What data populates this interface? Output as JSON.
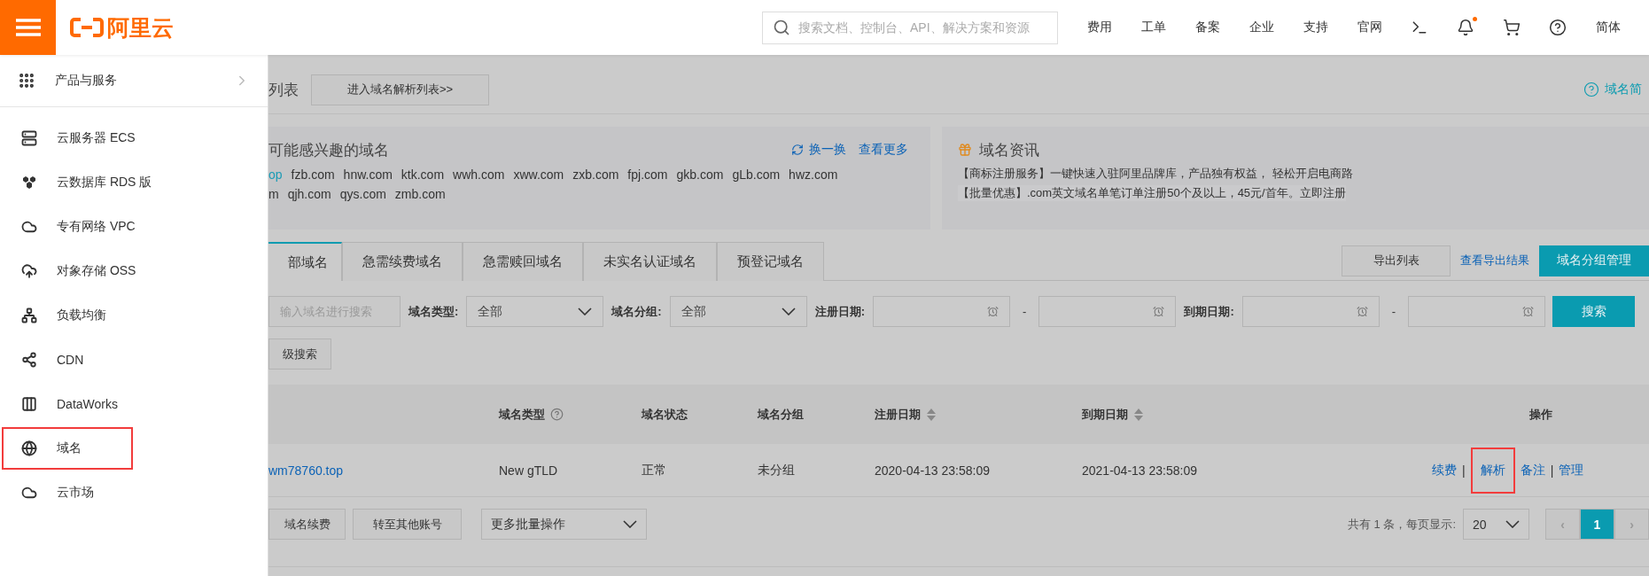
{
  "topbar": {
    "logo": "阿里云",
    "search": {
      "placeholder": "搜索文档、控制台、API、解决方案和资源"
    },
    "nav": [
      "费用",
      "工单",
      "备案",
      "企业",
      "支持",
      "官网"
    ],
    "icons": [
      {
        "kind": "terminal",
        "dot": false
      },
      {
        "kind": "bell",
        "dot": true
      },
      {
        "kind": "cart",
        "dot": false
      },
      {
        "kind": "help",
        "dot": false
      }
    ],
    "language": "简体"
  },
  "sidebar": {
    "header": "产品与服务",
    "items": [
      {
        "label": "云服务器 ECS",
        "highlighted": false
      },
      {
        "label": "云数据库 RDS 版",
        "highlighted": false
      },
      {
        "label": "专有网络 VPC",
        "highlighted": false
      },
      {
        "label": "对象存储 OSS",
        "highlighted": false
      },
      {
        "label": "负载均衡",
        "highlighted": false
      },
      {
        "label": "CDN",
        "highlighted": false
      },
      {
        "label": "DataWorks",
        "highlighted": false
      },
      {
        "label": "域名",
        "highlighted": true
      },
      {
        "label": "云市场",
        "highlighted": false
      }
    ]
  },
  "page": {
    "title": "列表",
    "resolve_button": "进入域名解析列表>>",
    "help_link": "域名简",
    "suggest": {
      "title": "可能感兴趣的域名",
      "refresh": "换一换",
      "more": "查看更多",
      "lines": [
        [
          {
            "text": "op",
            "color": "#1a9bb5"
          },
          {
            "text": "fzb.com",
            "color": "#333333"
          },
          {
            "text": "hnw.com",
            "color": "#333333"
          },
          {
            "text": "ktk.com",
            "color": "#333333"
          },
          {
            "text": "wwh.com",
            "color": "#333333"
          },
          {
            "text": "xww.com",
            "color": "#333333"
          },
          {
            "text": "zxb.com",
            "color": "#333333"
          },
          {
            "text": "fpj.com",
            "color": "#333333"
          },
          {
            "text": "gkb.com",
            "color": "#333333"
          },
          {
            "text": "gLb.com",
            "color": "#333333"
          },
          {
            "text": "hwz.com",
            "color": "#333333"
          }
        ],
        [
          {
            "text": "m",
            "color": "#333333"
          },
          {
            "text": "qjh.com",
            "color": "#333333"
          },
          {
            "text": "qys.com",
            "color": "#333333"
          },
          {
            "text": "zmb.com",
            "color": "#333333"
          }
        ]
      ]
    },
    "news": {
      "title": "域名资讯",
      "items": [
        "【商标注册服务】一键快速入驻阿里品牌库，产品独有权益， 轻松开启电商路",
        "【批量优惠】.com英文域名单笔订单注册50个及以上，45元/首年。立即注册"
      ]
    },
    "tabs": [
      {
        "label": "部域名",
        "selected": true
      },
      {
        "label": "急需续费域名",
        "selected": false
      },
      {
        "label": "急需赎回域名",
        "selected": false
      },
      {
        "label": "未实名认证域名",
        "selected": false
      },
      {
        "label": "预登记域名",
        "selected": false
      }
    ],
    "export_button": "导出列表",
    "export_result": "查看导出结果",
    "group_button": "域名分组管理",
    "filters": {
      "search": {
        "placeholder": "输入域名进行搜索"
      },
      "type_label": "域名类型:",
      "type_value": "全部",
      "group_label": "域名分组:",
      "group_value": "全部",
      "reg_label": "注册日期:",
      "exp_label": "到期日期:",
      "dash": "-",
      "search_button": "搜索",
      "advanced": "级搜索"
    },
    "table": {
      "columns": [
        {
          "label": "域名类型",
          "help": true,
          "sort": false
        },
        {
          "label": "域名状态",
          "help": false,
          "sort": false
        },
        {
          "label": "域名分组",
          "help": false,
          "sort": false
        },
        {
          "label": "注册日期",
          "help": false,
          "sort": true
        },
        {
          "label": "到期日期",
          "help": false,
          "sort": true
        },
        {
          "label": "操作",
          "help": false,
          "sort": false
        }
      ],
      "rows": [
        {
          "domain": "wm78760.top",
          "type": "New gTLD",
          "status": "正常",
          "group": "未分组",
          "registered": "2020-04-13 23:58:09",
          "expires": "2021-04-13 23:58:09",
          "actions": [
            {
              "label": "续费",
              "highlighted": false
            },
            {
              "label": "解析",
              "highlighted": true
            },
            {
              "label": "备注",
              "highlighted": false
            },
            {
              "label": "管理",
              "highlighted": false
            }
          ],
          "separator": "|"
        }
      ]
    },
    "footer": {
      "renew": "域名续费",
      "transfer": "转至其他账号",
      "batch": "更多批量操作",
      "total": "共有 1 条，每页显示:",
      "page_size": "20",
      "pages": [
        {
          "label": "1",
          "selected": true
        }
      ],
      "prev": "‹",
      "next": "›"
    }
  }
}
